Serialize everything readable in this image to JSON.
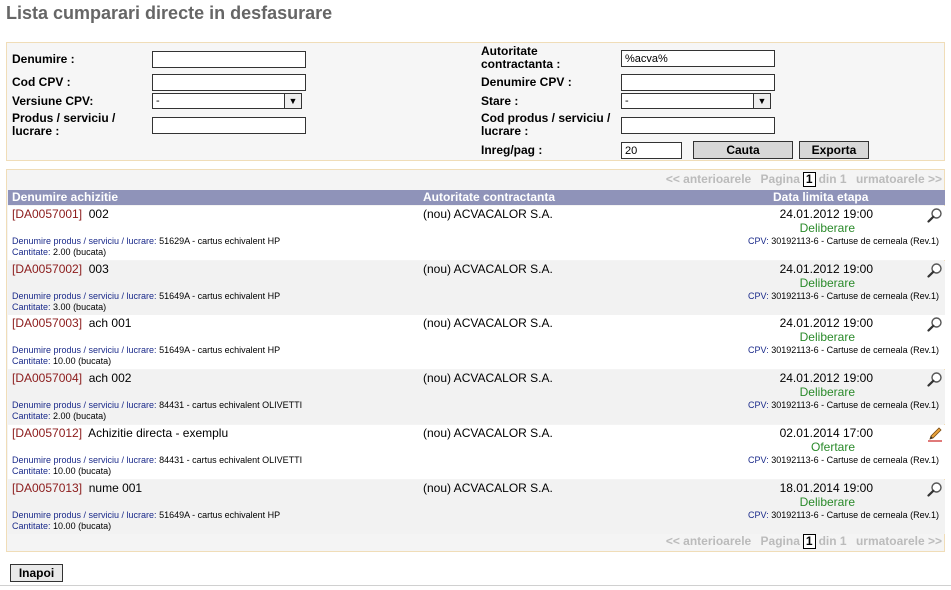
{
  "page": {
    "title": "Lista cumparari directe in desfasurare"
  },
  "search": {
    "denumire_label": "Denumire :",
    "denumire_value": "",
    "cod_cpv_label": "Cod CPV :",
    "cod_cpv_value": "",
    "versiune_cpv_label": "Versiune CPV:",
    "versiune_cpv_value": "-",
    "produs_label_1": "Produs / serviciu /",
    "produs_label_2": "lucrare :",
    "produs_value": "",
    "autoritate_label_1": "Autoritate",
    "autoritate_label_2": "contractanta :",
    "autoritate_value": "%acva%",
    "denumire_cpv_label": "Denumire CPV :",
    "denumire_cpv_value": "",
    "stare_label": "Stare :",
    "stare_value": "-",
    "cod_produs_label_1": "Cod produs / serviciu /",
    "cod_produs_label_2": "lucrare :",
    "cod_produs_value": "",
    "inreg_label": "Inreg/pag :",
    "inreg_value": "20",
    "search_button": "Cauta",
    "export_button": "Exporta"
  },
  "pager": {
    "prev": "<< anterioarele",
    "page_label": "Pagina",
    "current": "1",
    "of": "din 1",
    "next": "urmatoarele >>"
  },
  "table": {
    "headers": [
      "Denumire achizitie",
      "Autoritate contractanta",
      "Data limita etapa"
    ],
    "product_key": "Denumire produs / serviciu / lucrare:",
    "qty_key": "Cantitate:",
    "cpv_key": "CPV:",
    "rows": [
      {
        "id": "[DA0057001]",
        "name": "002",
        "authority": "(nou) ACVACALOR S.A.",
        "date": "24.01.2012 19:00",
        "stage": "Deliberare",
        "product": "51629A - cartus echivalent HP",
        "qty": "2.00 (bucata)",
        "cpv": "30192113-6 - Cartuse de cerneala (Rev.1)",
        "icon": "magnifier-icon"
      },
      {
        "id": "[DA0057002]",
        "name": "003",
        "authority": "(nou) ACVACALOR S.A.",
        "date": "24.01.2012 19:00",
        "stage": "Deliberare",
        "product": "51649A - cartus echivalent HP",
        "qty": "3.00 (bucata)",
        "cpv": "30192113-6 - Cartuse de cerneala (Rev.1)",
        "icon": "magnifier-icon"
      },
      {
        "id": "[DA0057003]",
        "name": "ach 001",
        "authority": "(nou) ACVACALOR S.A.",
        "date": "24.01.2012 19:00",
        "stage": "Deliberare",
        "product": "51649A - cartus echivalent HP",
        "qty": "10.00 (bucata)",
        "cpv": "30192113-6 - Cartuse de cerneala (Rev.1)",
        "icon": "magnifier-icon"
      },
      {
        "id": "[DA0057004]",
        "name": "ach 002",
        "authority": "(nou) ACVACALOR S.A.",
        "date": "24.01.2012 19:00",
        "stage": "Deliberare",
        "product": "84431 - cartus echivalent OLIVETTI",
        "qty": "2.00 (bucata)",
        "cpv": "30192113-6 - Cartuse de cerneala (Rev.1)",
        "icon": "magnifier-icon"
      },
      {
        "id": "[DA0057012]",
        "name": "Achizitie directa - exemplu",
        "authority": "(nou) ACVACALOR S.A.",
        "date": "02.01.2014 17:00",
        "stage": "Ofertare",
        "product": "84431 - cartus echivalent OLIVETTI",
        "qty": "10.00 (bucata)",
        "cpv": "30192113-6 - Cartuse de cerneala (Rev.1)",
        "icon": "pencil-icon"
      },
      {
        "id": "[DA0057013]",
        "name": "nume 001",
        "authority": "(nou) ACVACALOR S.A.",
        "date": "18.01.2014 19:00",
        "stage": "Deliberare",
        "product": "51649A - cartus echivalent HP",
        "qty": "10.00 (bucata)",
        "cpv": "30192113-6 - Cartuse de cerneala (Rev.1)",
        "icon": "magnifier-icon"
      }
    ]
  },
  "footer": {
    "back_button": "Inapoi"
  },
  "colors": {
    "header_bg": "#8f93b9",
    "id_color": "#8b1a1a",
    "stage_color": "#2a8a2a",
    "key_color": "#1a2a8a",
    "panel_border": "#f0ddb8"
  }
}
